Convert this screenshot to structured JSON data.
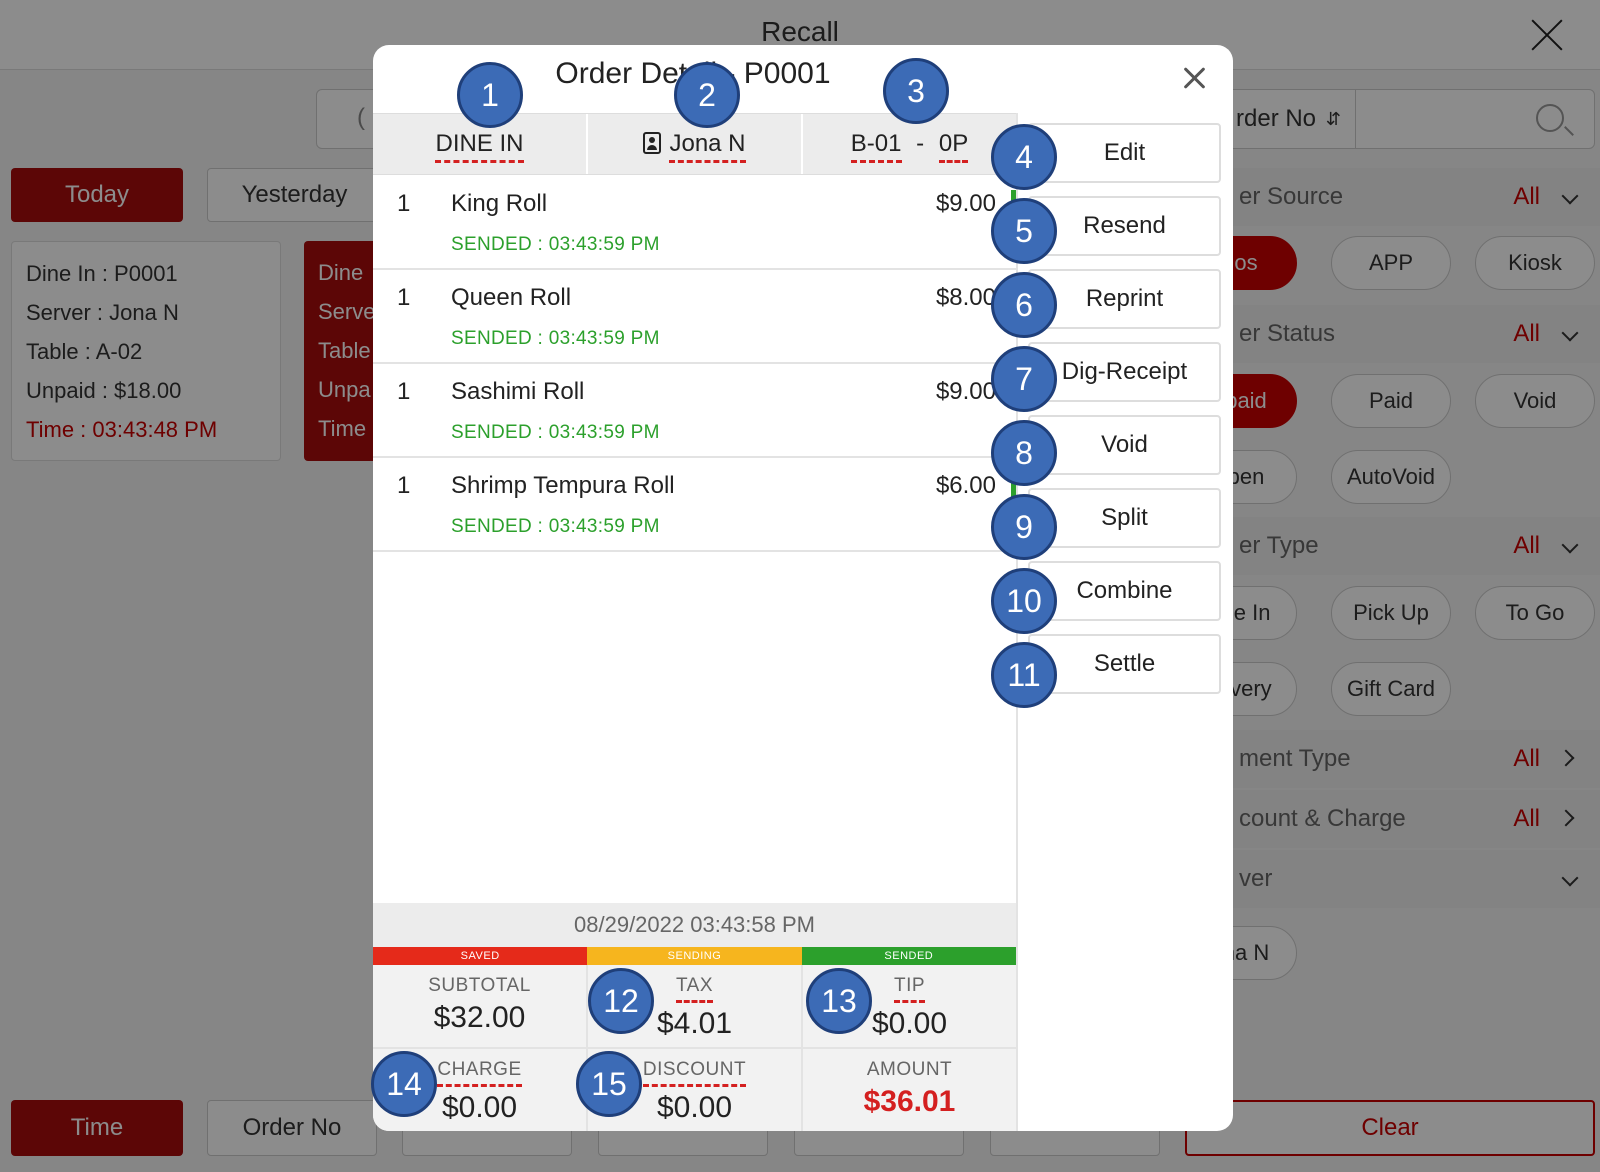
{
  "app": {
    "title": "Recall",
    "search_placeholder": "(",
    "filter_select_label": "rder No",
    "date_buttons": {
      "today": "Today",
      "yesterday": "Yesterday"
    },
    "card": {
      "dine_in": "Dine In  :  P0001",
      "server": "Server  :  Jona N",
      "table": "Table  :  A-02",
      "unpaid": "Unpaid  :  $18.00",
      "time": "Time  :  03:43:48 PM"
    },
    "card2": {
      "line1": "Dine",
      "line2": "Serve",
      "line3": "Table",
      "line4": "Unpa",
      "line5": "Time"
    },
    "filters": {
      "order_source": {
        "label": "er Source",
        "all": "All",
        "options": [
          "os",
          "APP",
          "Kiosk"
        ]
      },
      "order_status": {
        "label": "er Status",
        "all": "All",
        "options": [
          "paid",
          "Paid",
          "Void",
          "pen",
          "AutoVoid"
        ]
      },
      "order_type": {
        "label": "er Type",
        "all": "All",
        "options": [
          "ne In",
          "Pick Up",
          "To Go",
          "livery",
          "Gift Card"
        ]
      },
      "payment_type": {
        "label": "ment Type",
        "all": "All"
      },
      "discount_charge": {
        "label": "count & Charge",
        "all": "All"
      },
      "server": {
        "label": "ver",
        "options": [
          "na N"
        ]
      }
    },
    "bottom_buttons": {
      "time": "Time",
      "order_no": "Order No",
      "clear": "Clear"
    }
  },
  "modal": {
    "title": "Order Detail - P0001",
    "info": {
      "order_type": "DINE IN",
      "server": "Jona N",
      "table": "B-01",
      "separator": "-",
      "guests": "0P"
    },
    "items": [
      {
        "qty": "1",
        "name": "King Roll",
        "price": "$9.00",
        "status": "SENDED : 03:43:59 PM"
      },
      {
        "qty": "1",
        "name": "Queen Roll",
        "price": "$8.00",
        "status": "SENDED : 03:43:59 PM"
      },
      {
        "qty": "1",
        "name": "Sashimi Roll",
        "price": "$9.00",
        "status": "SENDED : 03:43:59 PM"
      },
      {
        "qty": "1",
        "name": "Shrimp Tempura Roll",
        "price": "$6.00",
        "status": "SENDED : 03:43:59 PM"
      }
    ],
    "actions": [
      "Edit",
      "Resend",
      "Reprint",
      "Dig-Receipt",
      "Void",
      "Split",
      "Combine",
      "Settle"
    ],
    "datetime": "08/29/2022 03:43:58 PM",
    "legend": [
      {
        "label": "SAVED",
        "color": "#e52a1a"
      },
      {
        "label": "SENDING",
        "color": "#f6b51e"
      },
      {
        "label": "SENDED",
        "color": "#2ca02c"
      }
    ],
    "totals": {
      "subtotal_label": "SUBTOTAL",
      "subtotal": "$32.00",
      "tax_label": "TAX",
      "tax": "$4.01",
      "tip_label": "TIP",
      "tip": "$0.00",
      "charge_label": "CHARGE",
      "charge": "$0.00",
      "discount_label": "DISCOUNT",
      "discount": "$0.00",
      "amount_label": "AMOUNT",
      "amount": "$36.01"
    }
  },
  "callouts": [
    "1",
    "2",
    "3",
    "4",
    "5",
    "6",
    "7",
    "8",
    "9",
    "10",
    "11",
    "12",
    "13",
    "14",
    "15"
  ]
}
